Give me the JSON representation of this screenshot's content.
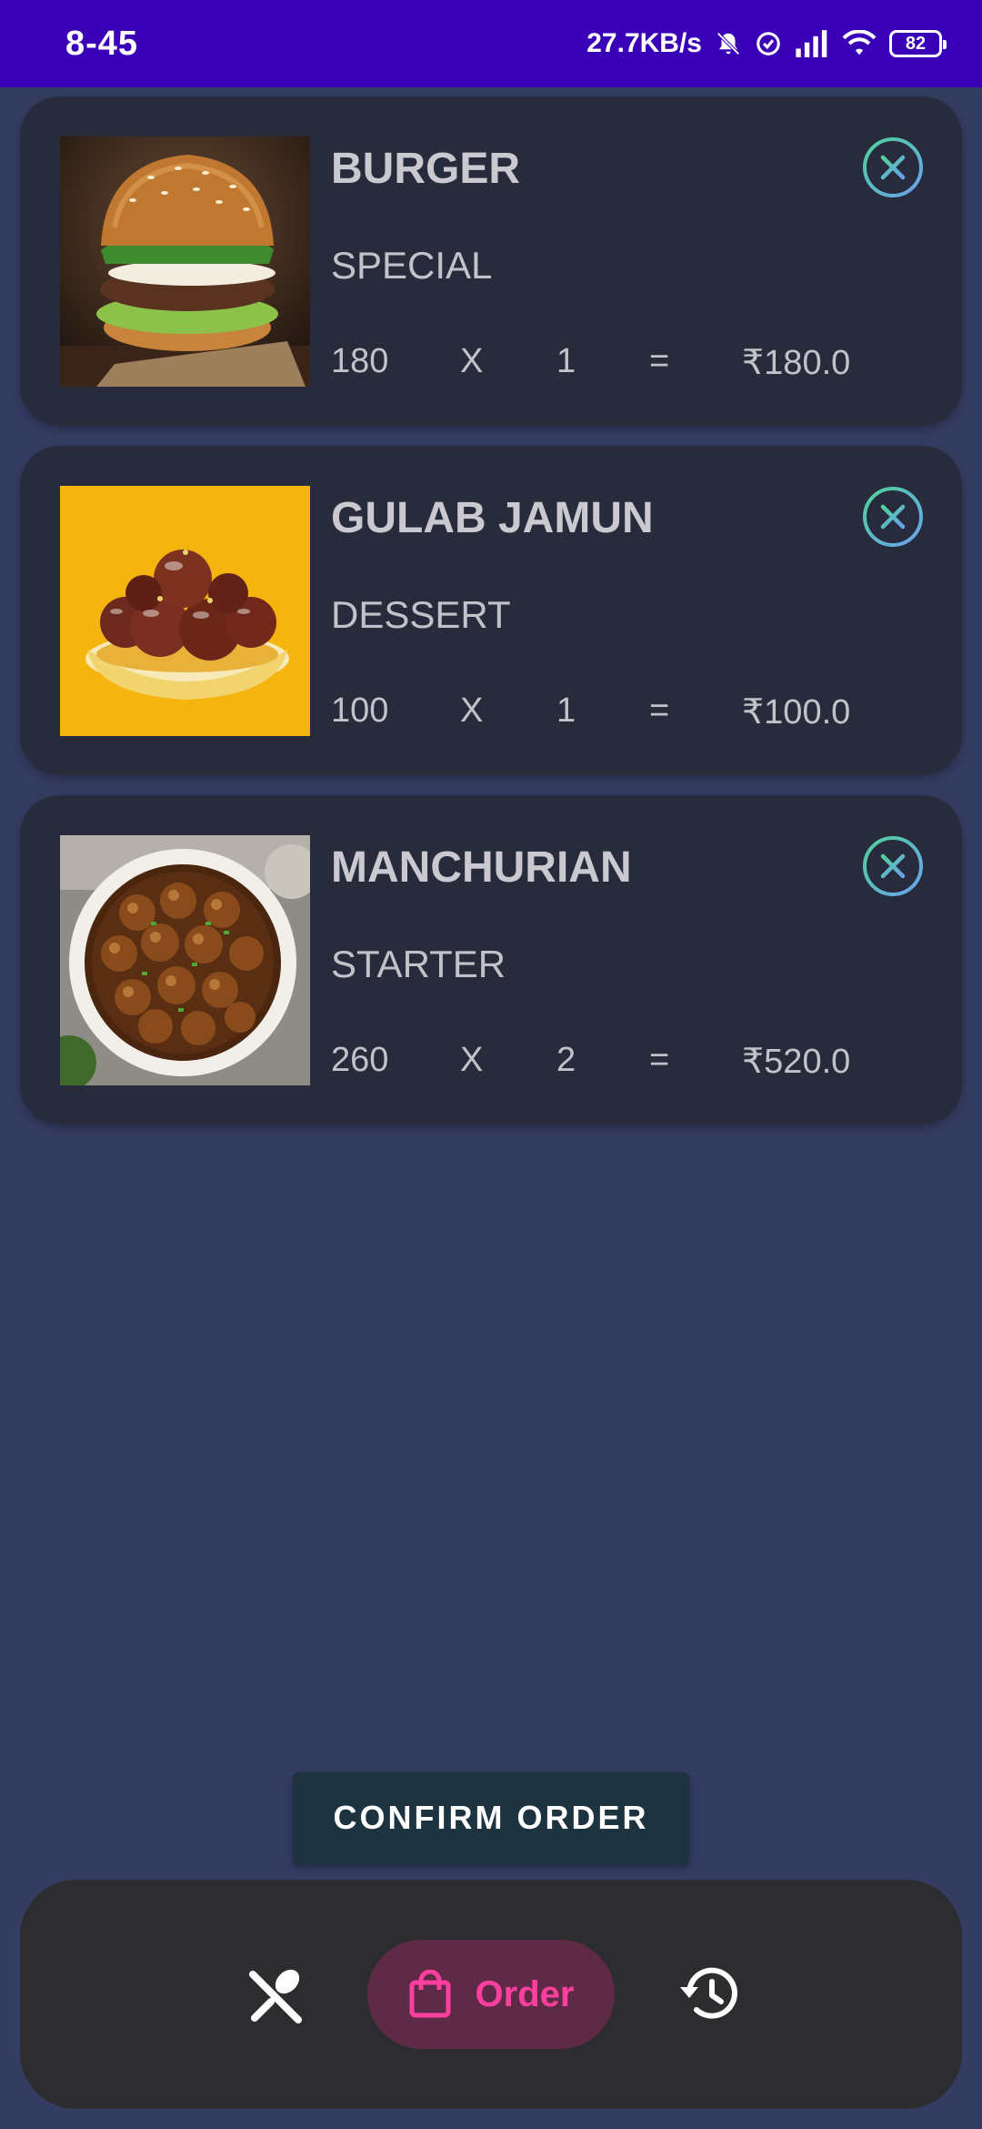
{
  "status": {
    "time": "8-45",
    "net_speed": "27.7KB/s",
    "battery": "82"
  },
  "cart": {
    "items": [
      {
        "name": "BURGER",
        "category": "SPECIAL",
        "price": "180",
        "times": "X",
        "qty": "1",
        "equals": "=",
        "total": "₹180.0",
        "image": "burger-image"
      },
      {
        "name": "GULAB JAMUN",
        "category": "DESSERT",
        "price": "100",
        "times": "X",
        "qty": "1",
        "equals": "=",
        "total": "₹100.0",
        "image": "gulab-jamun-image"
      },
      {
        "name": "MANCHURIAN",
        "category": "STARTER",
        "price": "260",
        "times": "X",
        "qty": "2",
        "equals": "=",
        "total": "₹520.0",
        "image": "manchurian-image"
      }
    ]
  },
  "actions": {
    "confirm_label": "CONFIRM ORDER"
  },
  "nav": {
    "menu_icon": "fork-spoon-icon",
    "order_label": "Order",
    "order_icon": "shopping-bag-icon",
    "history_icon": "history-icon"
  },
  "colors": {
    "status_bar": "#3a00b8",
    "background": "#343c61",
    "card": "#272b3c",
    "accent_pink": "#ff3fa0",
    "confirm_button": "#1d3340"
  }
}
